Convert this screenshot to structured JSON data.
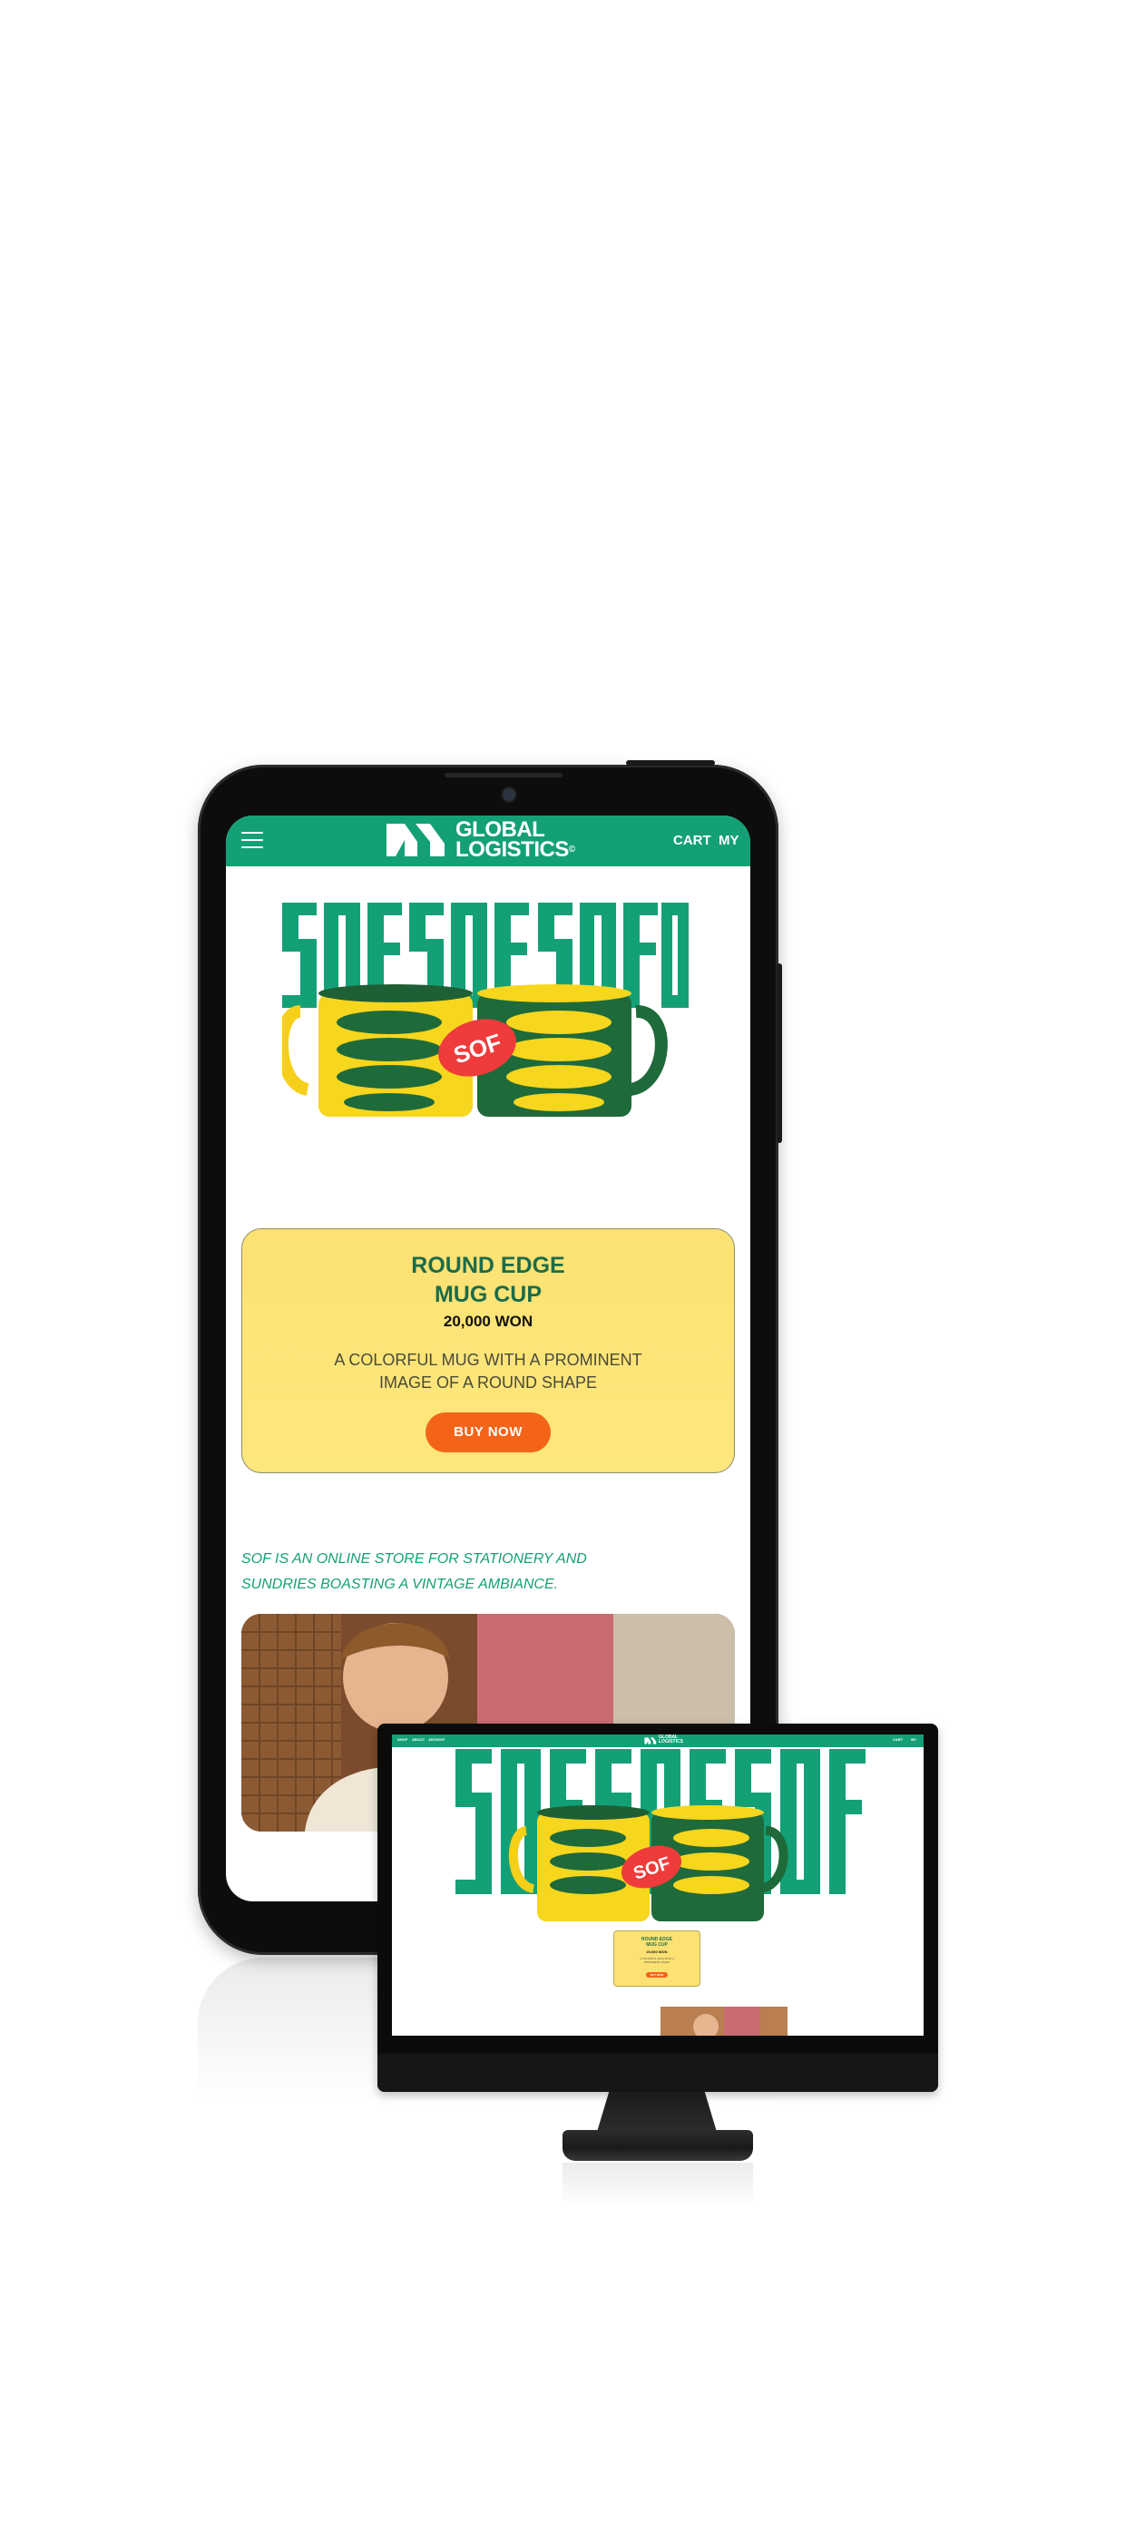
{
  "colors": {
    "brand_green": "#14a077",
    "dark_green": "#1d6b48",
    "card_yellow": "#fde273",
    "cta_orange": "#f36419"
  },
  "phone": {
    "header": {
      "menu_icon": "hamburger-icon",
      "logo_line1": "GLOBAL",
      "logo_line2": "LOGISTICS",
      "logo_mark": "©",
      "nav": [
        "CART",
        "MY"
      ]
    },
    "hero": {
      "backdrop_text": "SOFSOFSOF",
      "sticker": "SOF"
    },
    "product": {
      "title": "ROUND EDGE\nMUG CUP",
      "price": "20,000 WON",
      "description": "A COLORFUL MUG WITH A PROMINENT\nIMAGE OF A ROUND SHAPE",
      "cta": "BUY NOW"
    },
    "tagline": "SOF IS AN ONLINE STORE FOR STATIONERY AND\nSUNDRIES BOASTING A VINTAGE AMBIANCE."
  },
  "monitor": {
    "nav_left": [
      "SHOP",
      "ABOUT",
      "ARCHIVE"
    ],
    "logo_line1": "GLOBAL",
    "logo_line2": "LOGISTICS",
    "nav_right": [
      "CART",
      "MY"
    ],
    "sticker": "SOF",
    "product": {
      "title": "ROUND EDGE\nMUG CUP",
      "price": "20,000 WON",
      "description": "A COLORFUL MUG WITH A\nPROMINENT IMAGE",
      "cta": "BUY NOW"
    }
  }
}
